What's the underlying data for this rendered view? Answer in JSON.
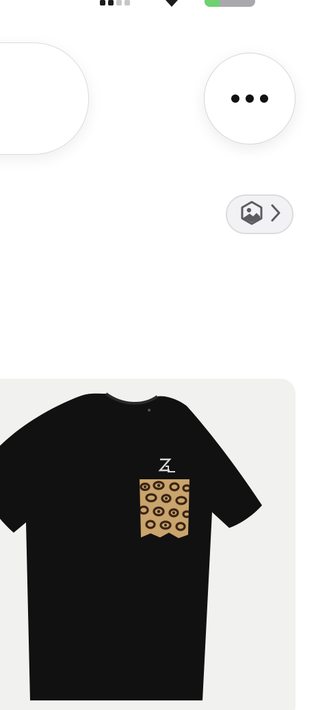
{
  "top_bar": {
    "back_control": "back-pill",
    "more_icon": "ellipsis-icon"
  },
  "image_link": {
    "icon": "photo-icon",
    "chevron": "chevron-right-icon"
  },
  "product": {
    "image": "black-t-shirt-with-leopard-pocket",
    "logo_text": "Z",
    "colors": {
      "shirt": "#111111",
      "card_background": "#f1f1ef",
      "pocket_base": "#c9a46c",
      "pocket_spots": "#3a2414"
    }
  },
  "colors": {
    "battery_fill": "#6fd16f",
    "battery_track": "#a9a9ad"
  }
}
